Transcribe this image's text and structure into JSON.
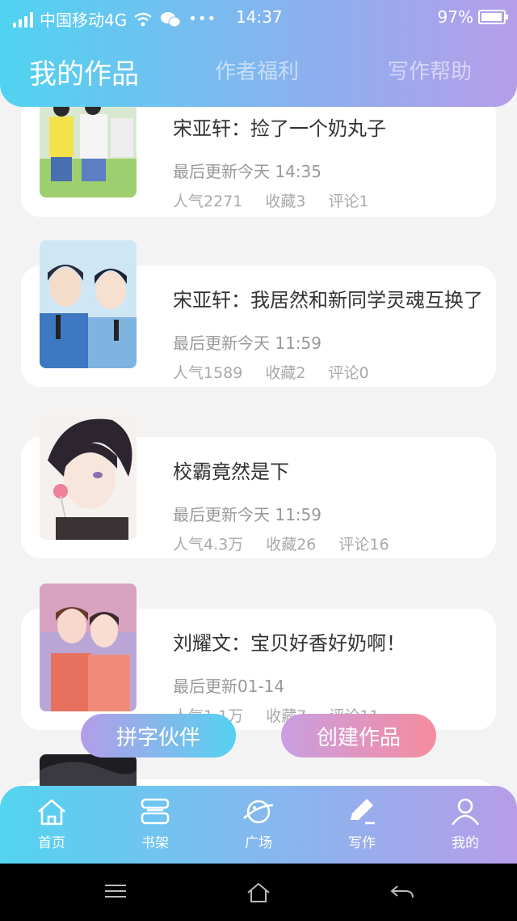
{
  "status_bar": {
    "carrier": "中国移动4G",
    "time": "14:37",
    "battery": "97%"
  },
  "header": {
    "tabs": [
      {
        "label": "我的作品",
        "active": true
      },
      {
        "label": "作者福利",
        "active": false
      },
      {
        "label": "写作帮助",
        "active": false
      }
    ]
  },
  "works": [
    {
      "title": "宋亚轩：捡了一个奶丸子",
      "updated": "最后更新今天 14:35",
      "popularity": "人气2271",
      "favorites": "收藏3",
      "comments": "评论1"
    },
    {
      "title": "宋亚轩：我居然和新同学灵魂互换了",
      "updated": "最后更新今天 11:59",
      "popularity": "人气1589",
      "favorites": "收藏2",
      "comments": "评论0"
    },
    {
      "title": "校霸竟然是下",
      "updated": "最后更新今天 11:59",
      "popularity": "人气4.3万",
      "favorites": "收藏26",
      "comments": "评论16"
    },
    {
      "title": "刘耀文：宝贝好香好奶啊！",
      "updated": "最后更新01-14",
      "popularity": "人气1.1万",
      "favorites": "收藏7",
      "comments": "评论11"
    }
  ],
  "actions": {
    "left": "拼字伙伴",
    "right": "创建作品"
  },
  "bottom_nav": [
    {
      "label": "首页",
      "icon": "home-icon"
    },
    {
      "label": "书架",
      "icon": "bookshelf-icon"
    },
    {
      "label": "广场",
      "icon": "planet-icon"
    },
    {
      "label": "写作",
      "icon": "pen-icon"
    },
    {
      "label": "我的",
      "icon": "user-icon"
    }
  ],
  "colors": {
    "gradient_start": "#50d3f1",
    "gradient_end": "#b59de9",
    "create_button_end": "#f58c9e"
  }
}
